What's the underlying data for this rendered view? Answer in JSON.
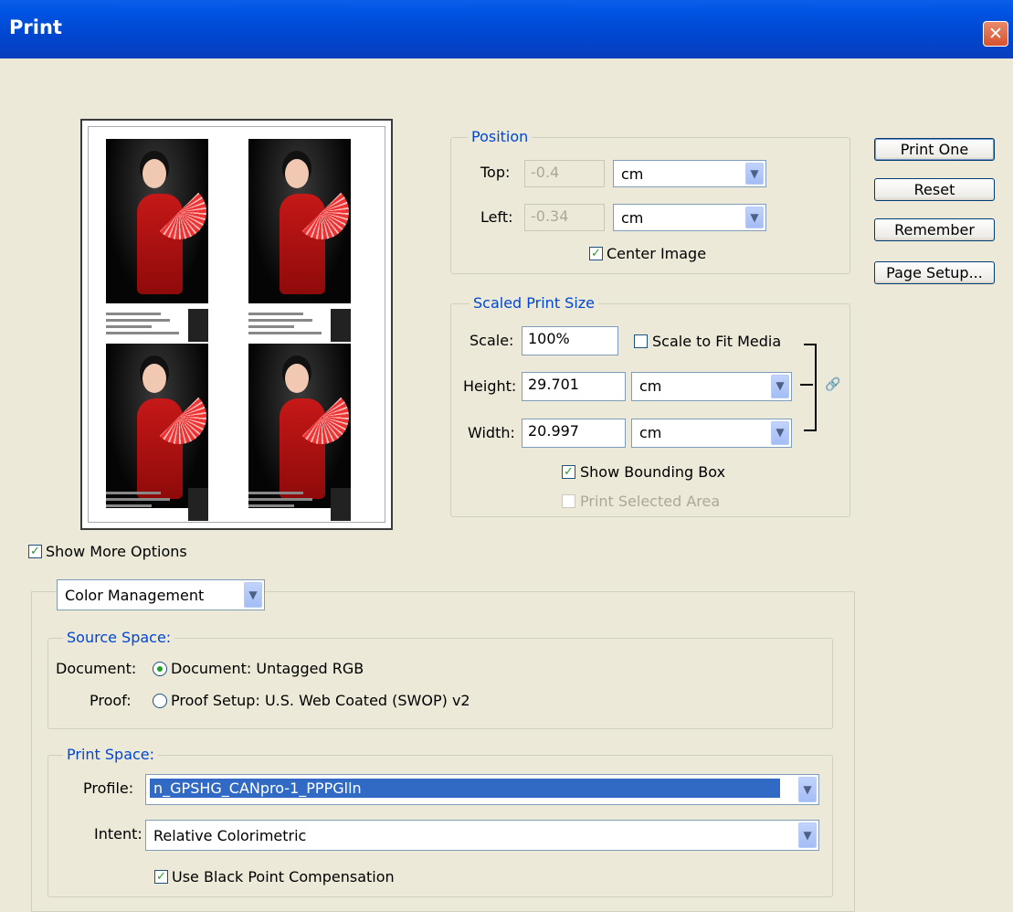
{
  "window": {
    "title": "Print",
    "close_icon": "close-icon"
  },
  "position": {
    "legend": "Position",
    "top_label": "Top:",
    "top_value": "-0.4",
    "top_unit": "cm",
    "left_label": "Left:",
    "left_value": "-0.34",
    "left_unit": "cm",
    "center_image_label": "Center Image",
    "center_image_checked": true
  },
  "scaled": {
    "legend": "Scaled Print Size",
    "scale_label": "Scale:",
    "scale_value": "100%",
    "fit_label": "Scale to Fit Media",
    "fit_checked": false,
    "height_label": "Height:",
    "height_value": "29.701",
    "height_unit": "cm",
    "width_label": "Width:",
    "width_value": "20.997",
    "width_unit": "cm",
    "bbox_label": "Show Bounding Box",
    "bbox_checked": true,
    "selected_label": "Print Selected Area",
    "selected_checked": false
  },
  "buttons": {
    "print_one": "Print One",
    "reset": "Reset",
    "remember": "Remember",
    "page_setup": "Page Setup..."
  },
  "more_options": {
    "label": "Show More Options",
    "checked": true
  },
  "mode_select": "Color Management",
  "source": {
    "legend": "Source Space:",
    "document_label": "Document:",
    "document_option": "Document:  Untagged RGB",
    "proof_label": "Proof:",
    "proof_option": "Proof Setup:  U.S. Web Coated (SWOP) v2",
    "selected": "document"
  },
  "print_space": {
    "legend": "Print Space:",
    "profile_label": "Profile:",
    "profile_value": "n_GPSHG_CANpro-1_PPPGlln",
    "intent_label": "Intent:",
    "intent_value": "Relative Colorimetric",
    "bpc_label": "Use Black Point Compensation",
    "bpc_checked": true
  },
  "colors": {
    "title_bar": "#0054e3",
    "legend_text": "#0046d5",
    "selection": "#316ac5"
  }
}
